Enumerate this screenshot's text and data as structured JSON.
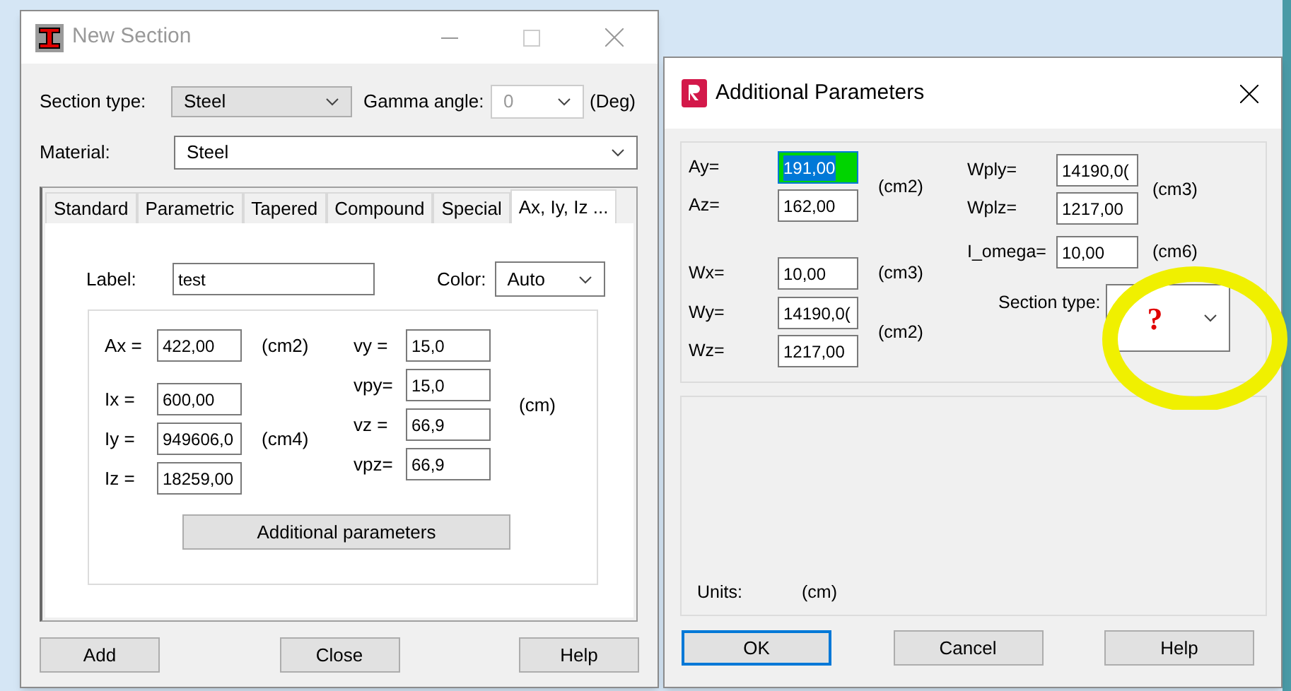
{
  "section_window": {
    "title": "New Section",
    "active": false,
    "section_type_label": "Section type:",
    "section_type": "Steel",
    "gamma_label": "Gamma angle:",
    "gamma_value": "0",
    "gamma_disabled": true,
    "gamma_unit": "(Deg)",
    "material_label": "Material:",
    "material": "Steel",
    "tabs": [
      {
        "label": "Standard",
        "selected": false
      },
      {
        "label": "Parametric",
        "selected": false
      },
      {
        "label": "Tapered",
        "selected": false
      },
      {
        "label": "Compound",
        "selected": false
      },
      {
        "label": "Special",
        "selected": false
      },
      {
        "label": "Ax, Iy, Iz ...",
        "selected": true
      }
    ],
    "label_label": "Label:",
    "label_value": "test",
    "color_label": "Color:",
    "color_value": "Auto",
    "left_groups": [
      {
        "rows": [
          {
            "label": "Ax =",
            "value": "422,00"
          }
        ],
        "unit": "(cm2)"
      },
      {
        "rows": [
          {
            "label": "Ix =",
            "value": "600,00"
          },
          {
            "label": "Iy =",
            "value": "949606,0"
          },
          {
            "label": "Iz =",
            "value": "18259,00"
          }
        ],
        "unit": "(cm4)"
      }
    ],
    "right_groups": [
      {
        "rows": [
          {
            "label": "vy =",
            "value": "15,0"
          },
          {
            "label": "vpy=",
            "value": "15,0"
          },
          {
            "label": "vz =",
            "value": "66,9"
          },
          {
            "label": "vpz=",
            "value": "66,9"
          }
        ],
        "unit": "(cm)"
      }
    ],
    "additional_button": "Additional parameters",
    "buttons": [
      "Add",
      "Close",
      "Help"
    ]
  },
  "params_window": {
    "title": "Additional Parameters",
    "active": true,
    "left_groups": [
      {
        "rows": [
          {
            "label": "Ay=",
            "value": "191,00",
            "selected": true
          },
          {
            "label": "Az=",
            "value": "162,00",
            "selected": false
          }
        ],
        "unit": "(cm2)"
      },
      {
        "rows": [
          {
            "label": "Wx=",
            "value": "10,00",
            "selected": false
          }
        ],
        "unit": "(cm3)"
      },
      {
        "rows": [
          {
            "label": "Wy=",
            "value": "14190,0(",
            "selected": false
          },
          {
            "label": "Wz=",
            "value": "1217,00",
            "selected": false
          }
        ],
        "unit": "(cm2)"
      }
    ],
    "right_groups": [
      {
        "rows": [
          {
            "label": "Wply=",
            "value": "14190,0(",
            "selected": false
          },
          {
            "label": "Wplz=",
            "value": "1217,00",
            "selected": false
          }
        ],
        "unit": "(cm3)"
      },
      {
        "rows": [
          {
            "label": "I_omega=",
            "value": "10,00",
            "selected": false
          }
        ],
        "unit": "(cm6)"
      }
    ],
    "section_type_label": "Section type:",
    "section_type": "?",
    "units_label": "Units:",
    "units_value": "(cm)",
    "buttons": [
      {
        "label": "OK",
        "default": true
      },
      {
        "label": "Cancel",
        "default": false
      },
      {
        "label": "Help",
        "default": false
      }
    ]
  }
}
